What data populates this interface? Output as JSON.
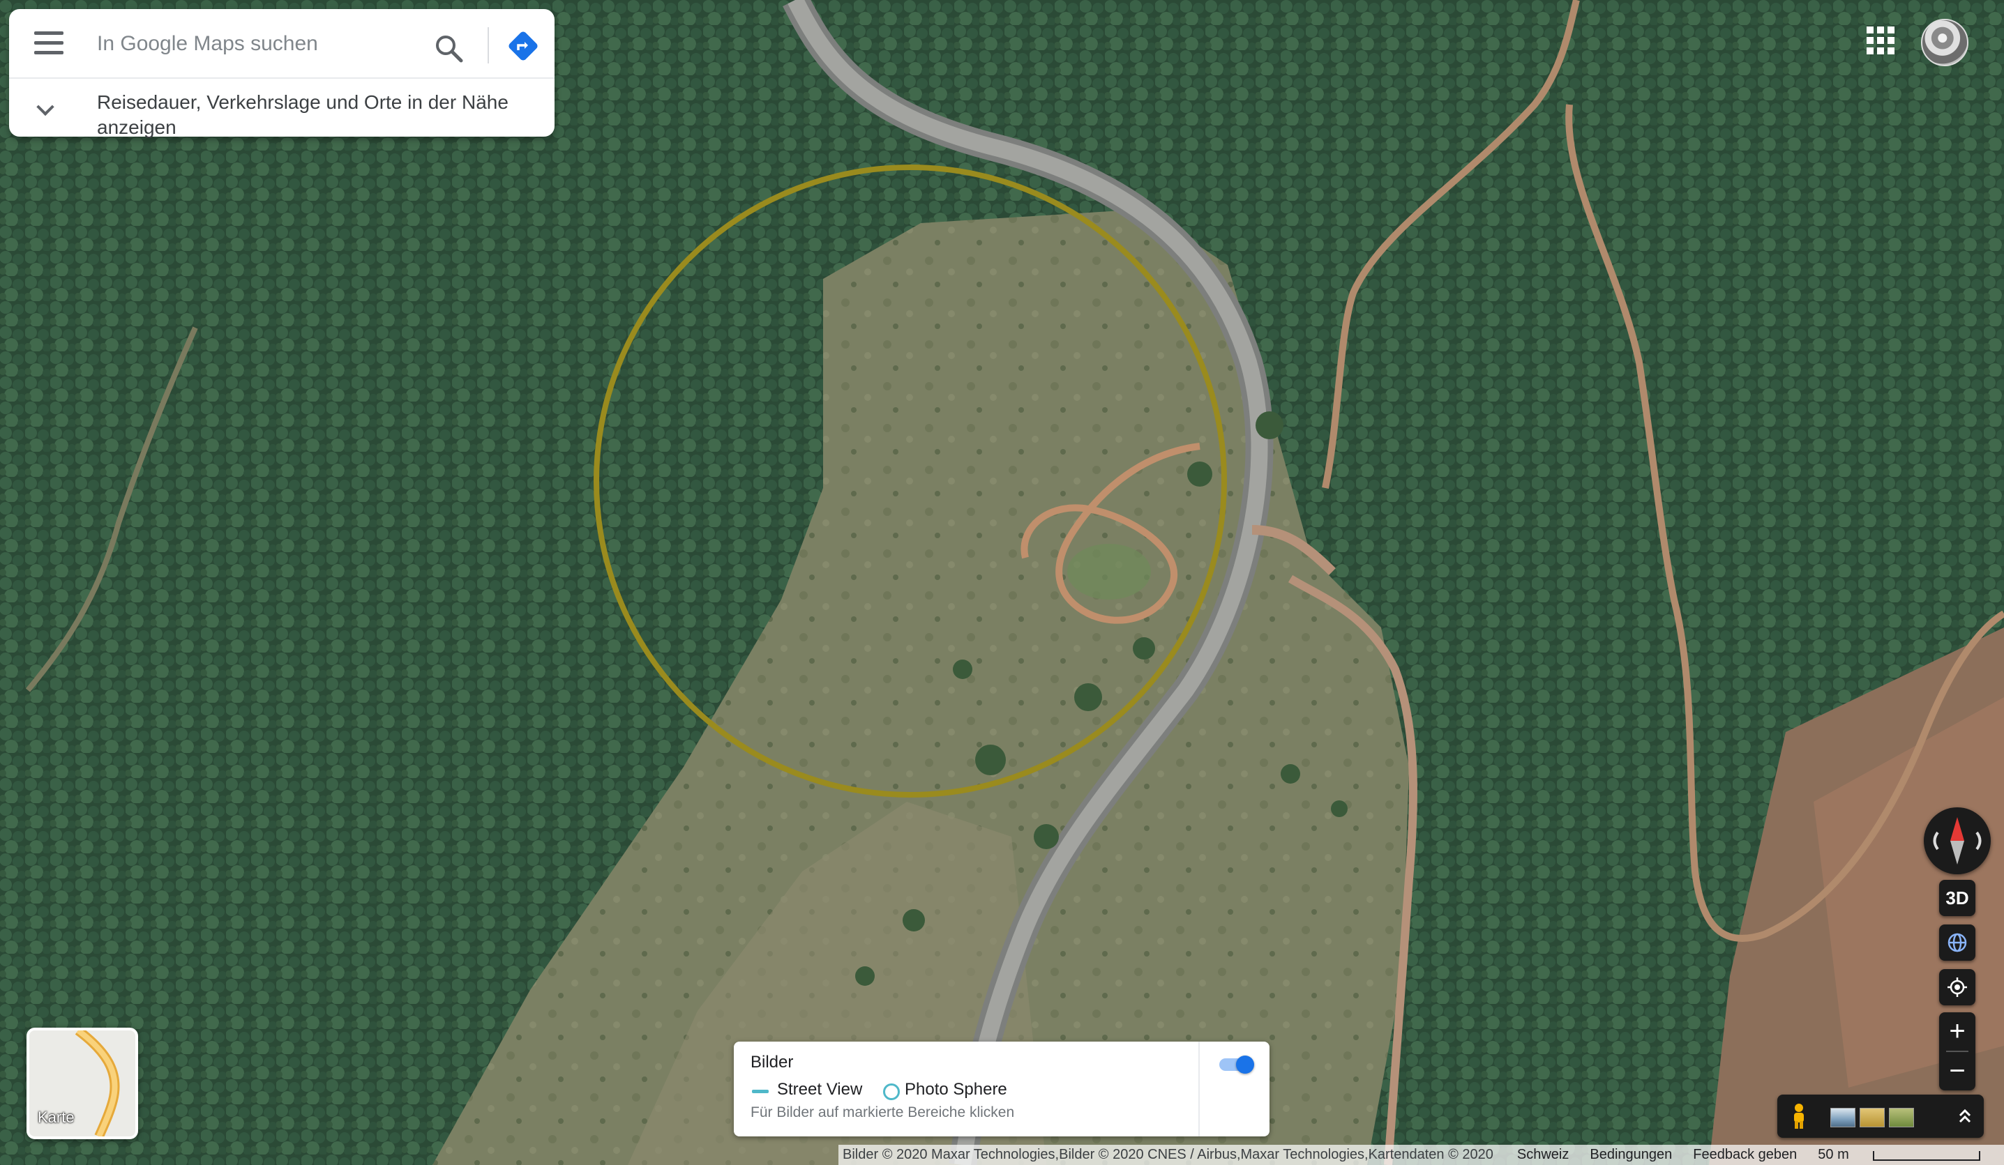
{
  "map": {
    "type": "satellite",
    "scale_label": "50 m"
  },
  "search": {
    "placeholder": "In Google Maps suchen",
    "expand_text": "Reisedauer, Verkehrslage und Orte in der Nähe anzeigen"
  },
  "layers": {
    "label": "Karte"
  },
  "imagery": {
    "title": "Bilder",
    "street_view": "Street View",
    "photo_sphere": "Photo Sphere",
    "hint": "Für Bilder auf markierte Bereiche klicken",
    "toggle_on": true,
    "street_view_color": "#4fb8c9",
    "toggle_color": "#1a73e8"
  },
  "controls": {
    "three_d": "3D",
    "zoom_in": "+",
    "zoom_out": "−"
  },
  "footer": {
    "attribution": "Bilder © 2020 Maxar Technologies,Bilder © 2020 CNES / Airbus,Maxar Technologies,Kartendaten © 2020",
    "country": "Schweiz",
    "terms": "Bedingungen",
    "feedback": "Feedback geben",
    "scale": "50 m"
  },
  "overlay": {
    "circle_color": "#9a8b1e"
  },
  "icons": [
    "menu-icon",
    "search-icon",
    "directions-icon",
    "chevron-down-icon",
    "apps-grid-icon",
    "compass-icon",
    "globe-icon",
    "my-location-icon",
    "pegman-icon",
    "expand-up-icon"
  ]
}
